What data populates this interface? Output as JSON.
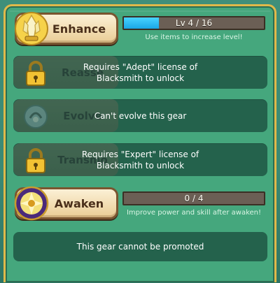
{
  "enhance": {
    "button_label": "Enhance",
    "icon": "crystal-enhance-icon",
    "level_text": "Lv 4 / 16",
    "level_current": 4,
    "level_max": 16,
    "hint": "Use items to increase level!"
  },
  "reassemble": {
    "ghost_label": "Reasse",
    "icon": "lock-icon",
    "message": "Requires \"Adept\" license of Blacksmith to unlock"
  },
  "evolve": {
    "ghost_label": "Evolve",
    "icon": "evolve-icon",
    "message": "Can't evolve this gear"
  },
  "transmute": {
    "ghost_label": "Transmo",
    "icon": "lock-icon",
    "message": "Requires \"Expert\" license of Blacksmith to unlock"
  },
  "awaken": {
    "button_label": "Awaken",
    "icon": "awaken-icon",
    "progress_text": "0 / 4",
    "progress_current": 0,
    "progress_max": 4,
    "hint": "Improve power and skill after awaken!"
  },
  "promote": {
    "message": "This gear cannot be promoted"
  },
  "colors": {
    "panel": "#45a77d",
    "row": "#24624c",
    "button": "#f2ddb2",
    "bar_fill": "#1aa7e6",
    "frame": "#e0b94a"
  }
}
